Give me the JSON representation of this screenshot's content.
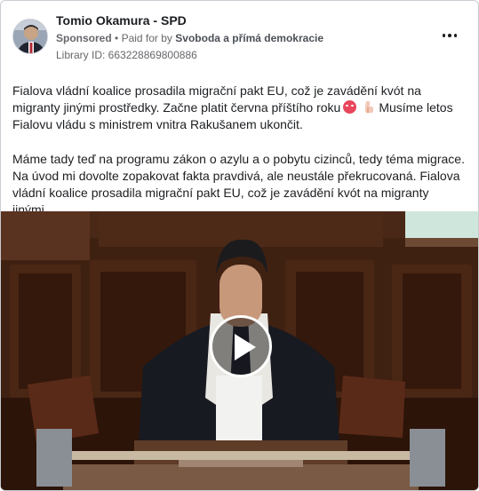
{
  "post": {
    "page_name": "Tomio Okamura - SPD",
    "sponsored": "Sponsored",
    "separator": "•",
    "paid_for_prefix": "Paid for by",
    "payer": "Svoboda a přímá demokracie",
    "library_id": "Library ID: 663228869800886",
    "more_icon": "more-horizontal-icon"
  },
  "body": {
    "p1_a": "Fialova vládní koalice prosadila migrační pakt EU, což je zavádění kvót na migranty jinými prostředky. Začne platit června příštího roku",
    "p1_b": "Musíme letos Fialovu vládu s ministrem vnitra Rakušanem ukončit.",
    "p2": "Máme tady teď na programu zákon o azylu a o pobytu cizinců, tedy téma migrace. Na úvod mi dovolte zopakovat fakta pravdivá, ale neustále překrucovaná. Fialova vládní koalice prosadila migrační pakt EU, což je zavádění kvót na migranty jinými…",
    "emoji_1": "angry-face-emoji",
    "emoji_2": "pointing-down-emoji"
  },
  "video": {
    "play_icon": "play-icon"
  },
  "colors": {
    "text": "#1c1e21",
    "meta": "#65676b",
    "border": "#c9ccd1",
    "video_bg": "#3a1d10"
  }
}
